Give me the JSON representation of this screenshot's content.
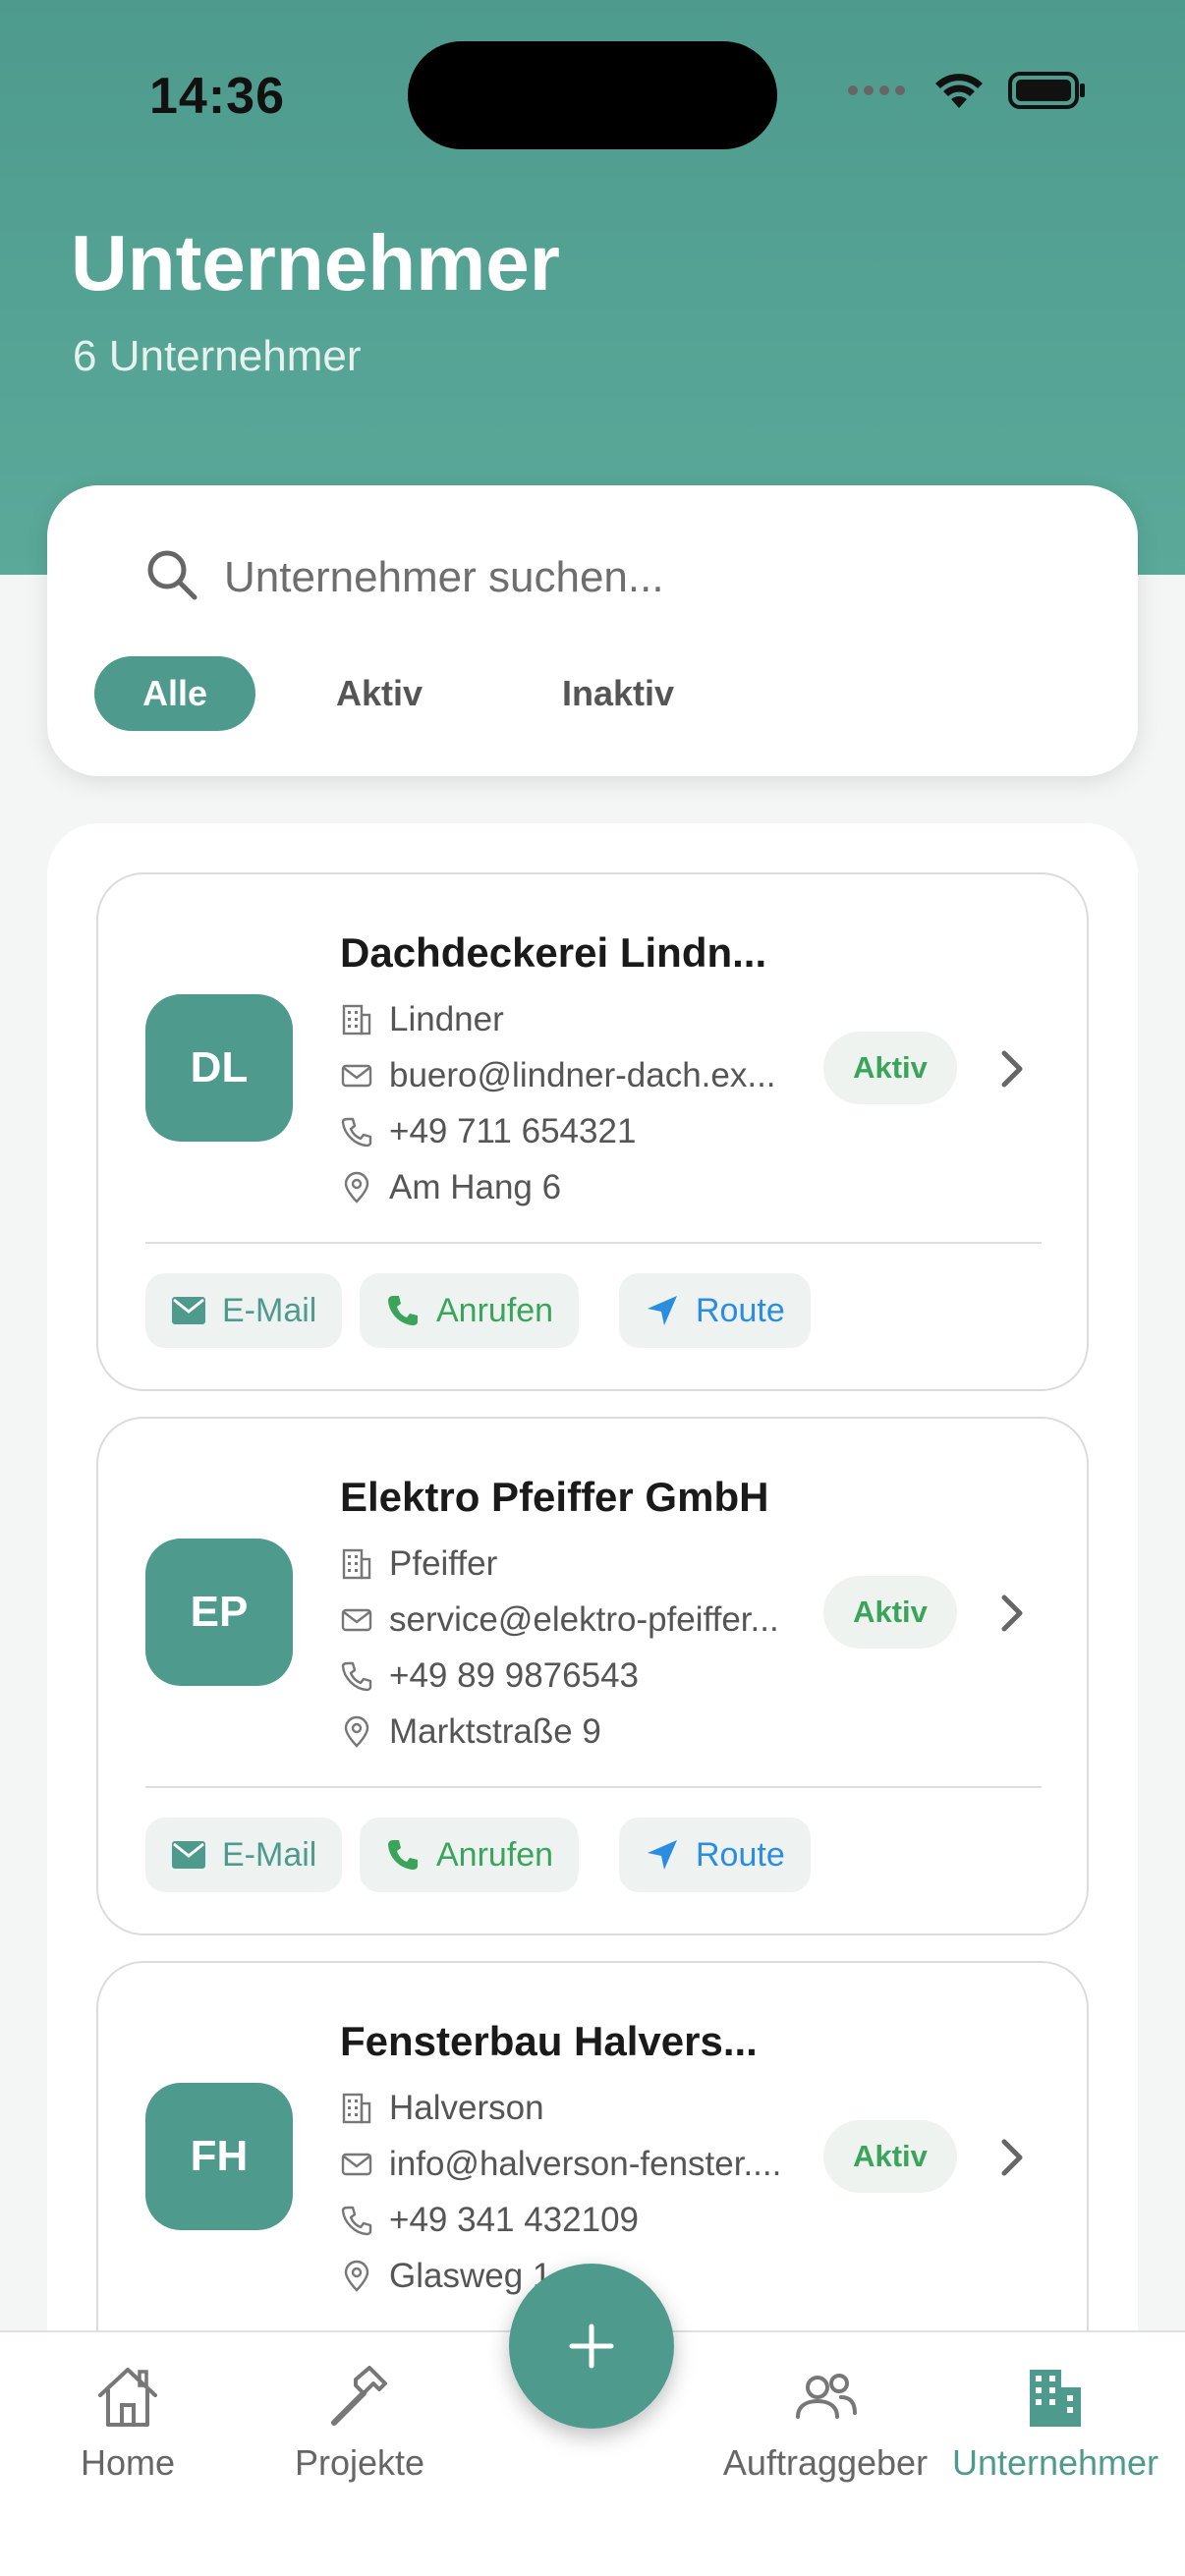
{
  "status_bar": {
    "time": "14:36"
  },
  "header": {
    "title": "Unternehmer",
    "subtitle": "6 Unternehmer"
  },
  "search": {
    "placeholder": "Unternehmer suchen..."
  },
  "filters": [
    {
      "label": "Alle",
      "active": true
    },
    {
      "label": "Aktiv",
      "active": false
    },
    {
      "label": "Inaktiv",
      "active": false
    }
  ],
  "contractors": [
    {
      "initials": "DL",
      "name": "Dachdeckerei Lindn...",
      "contact": "Lindner",
      "email": "buero@lindner-dach.ex...",
      "phone": "+49 711 654321",
      "address": "Am Hang 6",
      "status": "Aktiv"
    },
    {
      "initials": "EP",
      "name": "Elektro Pfeiffer GmbH",
      "contact": "Pfeiffer",
      "email": "service@elektro-pfeiffer...",
      "phone": "+49 89 9876543",
      "address": "Marktstraße 9",
      "status": "Aktiv"
    },
    {
      "initials": "FH",
      "name": "Fensterbau Halvers...",
      "contact": "Halverson",
      "email": "info@halverson-fenster....",
      "phone": "+49 341 432109",
      "address": "Glasweg 1",
      "status": "Aktiv"
    }
  ],
  "actions": {
    "email": "E-Mail",
    "call": "Anrufen",
    "route": "Route"
  },
  "nav": {
    "home": "Home",
    "projects": "Projekte",
    "clients": "Auftraggeber",
    "contractors": "Unternehmer"
  },
  "colors": {
    "primary": "#4e9b8d",
    "active_green": "#3aa55a",
    "route_blue": "#2b8de0"
  }
}
